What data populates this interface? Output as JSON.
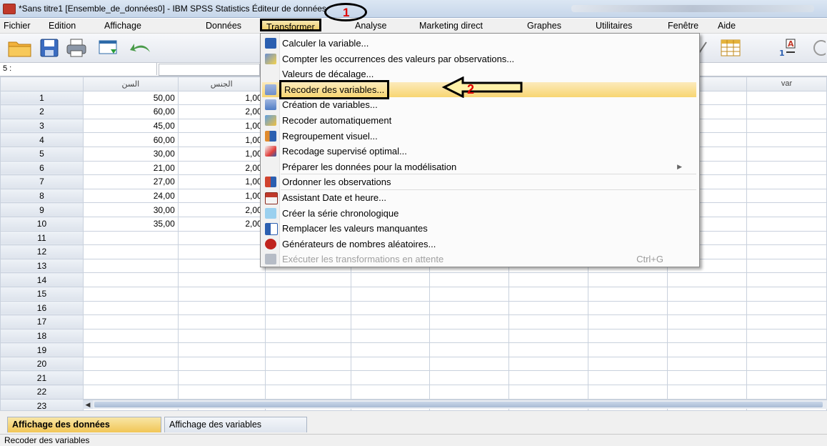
{
  "window": {
    "title": "*Sans titre1 [Ensemble_de_données0] - IBM SPSS Statistics Éditeur de données"
  },
  "menubar": {
    "items": [
      "Fichier",
      "Edition",
      "Affichage",
      "Données",
      "Transformer",
      "Analyse",
      "Marketing direct",
      "Graphes",
      "Utilitaires",
      "Fenêtre",
      "Aide"
    ],
    "active": "Transformer"
  },
  "cellbar": {
    "ref": "5 :"
  },
  "grid": {
    "columns": [
      "السن",
      "الجنس",
      "",
      "",
      "",
      "",
      "",
      "var",
      "var"
    ],
    "rows": [
      {
        "n": "1",
        "age": "50,00",
        "sex": "1,00"
      },
      {
        "n": "2",
        "age": "60,00",
        "sex": "2,00"
      },
      {
        "n": "3",
        "age": "45,00",
        "sex": "1,00"
      },
      {
        "n": "4",
        "age": "60,00",
        "sex": "1,00"
      },
      {
        "n": "5",
        "age": "30,00",
        "sex": "1,00"
      },
      {
        "n": "6",
        "age": "21,00",
        "sex": "2,00"
      },
      {
        "n": "7",
        "age": "27,00",
        "sex": "1,00"
      },
      {
        "n": "8",
        "age": "24,00",
        "sex": "1,00"
      },
      {
        "n": "9",
        "age": "30,00",
        "sex": "2,00"
      },
      {
        "n": "10",
        "age": "35,00",
        "sex": "2,00"
      },
      {
        "n": "11",
        "age": "",
        "sex": ""
      },
      {
        "n": "12",
        "age": "",
        "sex": ""
      },
      {
        "n": "13",
        "age": "",
        "sex": ""
      },
      {
        "n": "14",
        "age": "",
        "sex": ""
      },
      {
        "n": "15",
        "age": "",
        "sex": ""
      },
      {
        "n": "16",
        "age": "",
        "sex": ""
      },
      {
        "n": "17",
        "age": "",
        "sex": ""
      },
      {
        "n": "18",
        "age": "",
        "sex": ""
      },
      {
        "n": "19",
        "age": "",
        "sex": ""
      },
      {
        "n": "20",
        "age": "",
        "sex": ""
      },
      {
        "n": "21",
        "age": "",
        "sex": ""
      },
      {
        "n": "22",
        "age": "",
        "sex": ""
      },
      {
        "n": "23",
        "age": "",
        "sex": ""
      }
    ]
  },
  "menu": {
    "items": [
      {
        "label": "Calculer la variable...",
        "icon": "calculator-icon"
      },
      {
        "label": "Compter les occurrences des valeurs par observations...",
        "icon": "count-icon"
      },
      {
        "label": "Valeurs de décalage...",
        "icon": ""
      },
      {
        "label": "Recoder des variables...",
        "icon": "recode-icon",
        "highlighted": true
      },
      {
        "label": "Création de variables...",
        "icon": "create-variables-icon"
      },
      {
        "label": "Recoder automatiquement",
        "icon": "auto-recode-icon"
      },
      {
        "label": "Regroupement visuel...",
        "icon": "visual-binning-icon"
      },
      {
        "label": "Recodage supervisé optimal...",
        "icon": "optimal-binning-icon"
      },
      {
        "label": "Préparer les données pour la modélisation",
        "icon": "",
        "submenu": true
      },
      {
        "label": "Ordonner les observations",
        "icon": "rank-cases-icon"
      },
      {
        "label": "Assistant Date et heure...",
        "icon": "date-time-icon"
      },
      {
        "label": "Créer la série chronologique",
        "icon": "time-series-icon"
      },
      {
        "label": "Remplacer les valeurs manquantes",
        "icon": "replace-missing-icon"
      },
      {
        "label": "Générateurs de nombres aléatoires...",
        "icon": "dice-icon"
      },
      {
        "label": "Exécuter les transformations en attente",
        "icon": "run-pending-icon",
        "disabled": true,
        "shortcut": "Ctrl+G"
      }
    ]
  },
  "annotations": {
    "first": "1",
    "second": "2",
    "color": "#e00000"
  },
  "tabs": {
    "data_view": "Affichage des données",
    "variable_view": "Affichage des variables"
  },
  "status": {
    "text": "Recoder des variables"
  }
}
